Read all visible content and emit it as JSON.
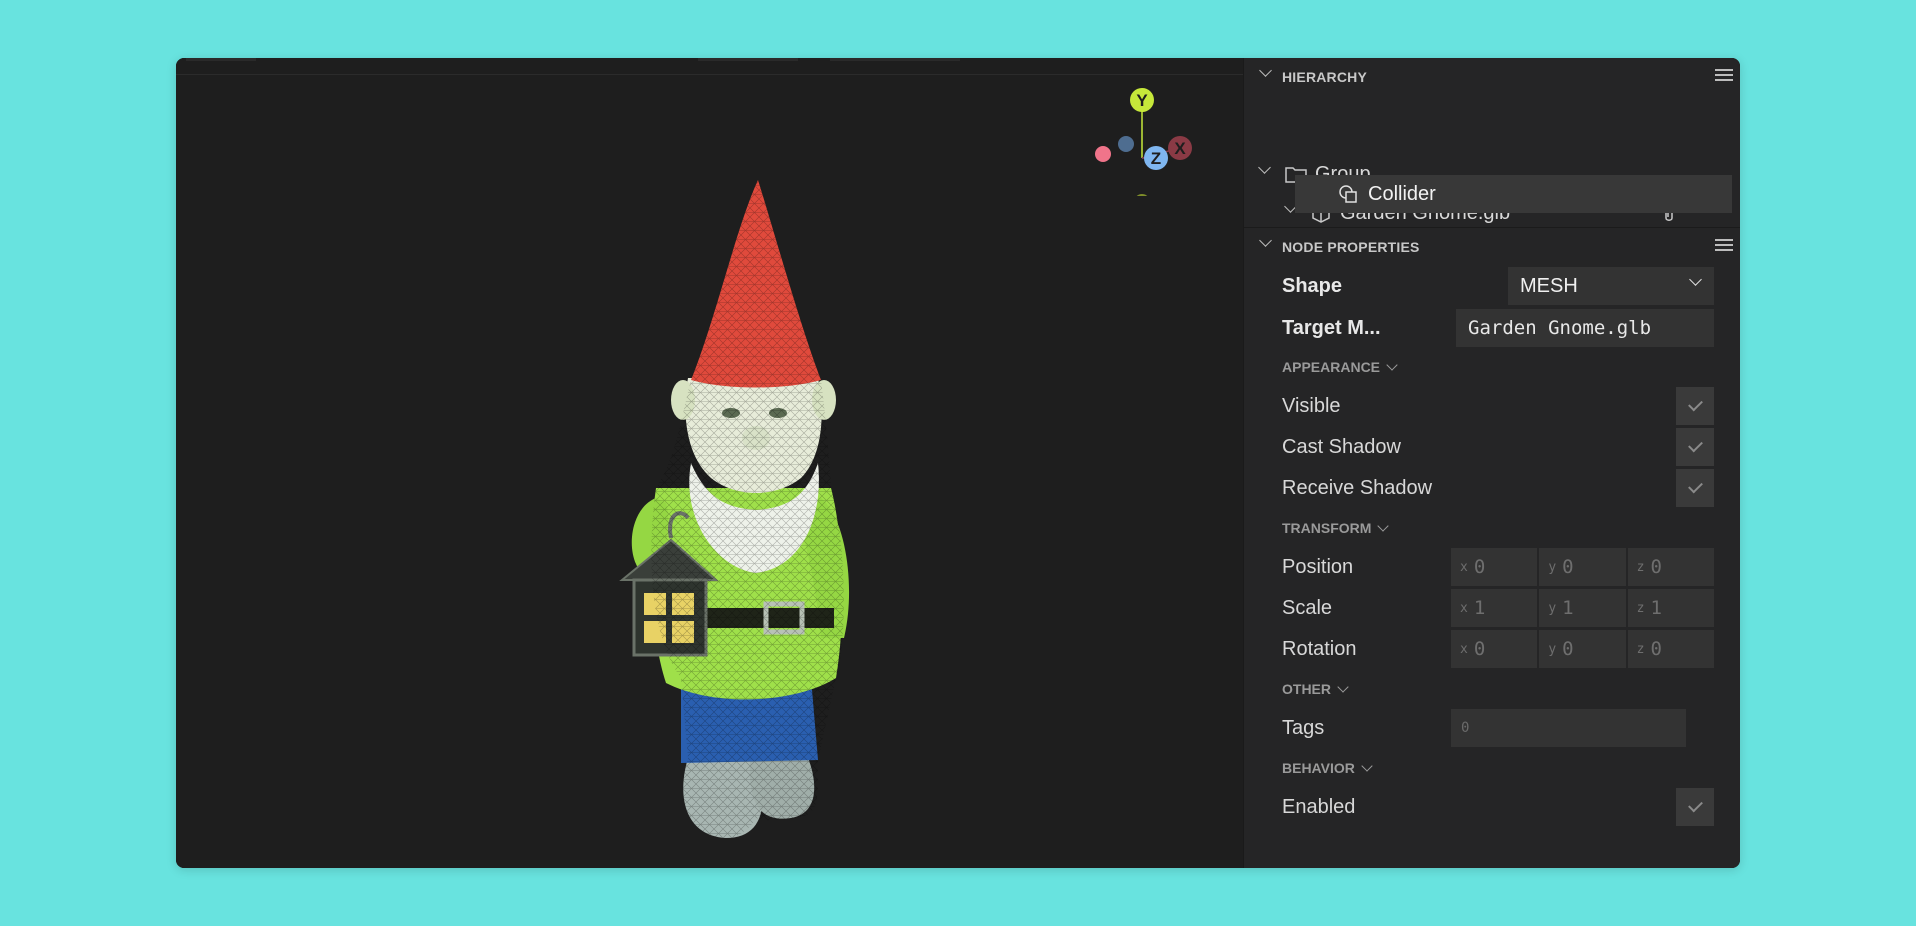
{
  "hierarchy": {
    "title": "HIERARCHY",
    "items": [
      {
        "label": "Group"
      },
      {
        "label": "Garden Gnome.glb"
      },
      {
        "label": "Collider"
      }
    ]
  },
  "gizmo": {
    "y": "Y",
    "x": "X",
    "z": "Z"
  },
  "node_properties": {
    "title": "NODE PROPERTIES",
    "shape_label": "Shape",
    "shape_value": "MESH",
    "target_label": "Target M...",
    "target_value": "Garden Gnome.glb",
    "appearance": {
      "title": "APPEARANCE",
      "visible": "Visible",
      "cast_shadow": "Cast Shadow",
      "receive_shadow": "Receive Shadow"
    },
    "transform": {
      "title": "TRANSFORM",
      "position": {
        "label": "Position",
        "x": "0",
        "y": "0",
        "z": "0"
      },
      "scale": {
        "label": "Scale",
        "x": "1",
        "y": "1",
        "z": "1"
      },
      "rotation": {
        "label": "Rotation",
        "x": "0",
        "y": "0",
        "z": "0"
      },
      "axes": {
        "x": "x",
        "y": "y",
        "z": "z"
      }
    },
    "other": {
      "title": "OTHER",
      "tags_label": "Tags",
      "tags_placeholder": "0"
    },
    "behavior": {
      "title": "BEHAVIOR",
      "enabled": "Enabled"
    }
  },
  "colors": {
    "background": "#68e3df",
    "panel": "#252526",
    "viewport": "#1e1e1e",
    "gizmo_y": "#c6e83a",
    "gizmo_x": "#8a3a45",
    "gizmo_z": "#7fb6f0"
  }
}
